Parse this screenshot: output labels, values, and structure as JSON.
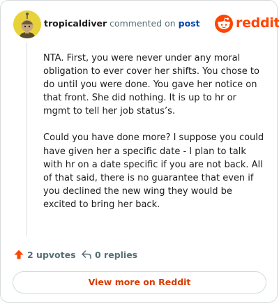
{
  "header": {
    "username": "tropicaldiver",
    "action_text": "commented on",
    "post_link": "post"
  },
  "brand": {
    "name": "reddit",
    "accent": "#ff4500"
  },
  "comment": {
    "paragraphs": [
      "NTA. First, you were never under any moral obligation to ever cover her shifts. You chose to do until you were done. You gave her notice on that front. She did nothing. It is up to hr or mgmt to tell her job status’s.",
      "Could you have done more? I suppose you could have given her a specific date - I plan to talk with hr on a date specific if you are not back. All of that said, there is no guarantee that even if you declined the new wing they would be excited to bring her back."
    ]
  },
  "actions": {
    "upvotes_label": "2 upvotes",
    "replies_label": "0 replies",
    "upvote_icon": "upvote-arrow-icon",
    "reply_icon": "reply-arrow-icon"
  },
  "footer": {
    "view_more_label": "View more on Reddit"
  }
}
